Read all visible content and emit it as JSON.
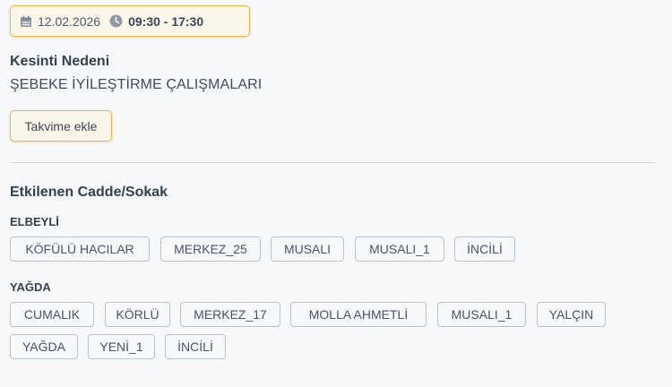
{
  "schedule": {
    "date": "12.02.2026",
    "time": "09:30 - 17:30",
    "icons": [
      "calendar-icon",
      "clock-icon"
    ]
  },
  "reason": {
    "label": "Kesinti Nedeni",
    "value": "ŞEBEKE İYİLEŞTİRME ÇALIŞMALARI"
  },
  "actions": {
    "add_to_calendar": "Takvime ekle"
  },
  "affected": {
    "title": "Etkilenen Cadde/Sokak",
    "groups": [
      {
        "name": "ELBEYLİ",
        "streets": [
          "KÖFÜLÜ HACILAR",
          "MERKEZ_25",
          "MUSALI",
          "MUSALI_1",
          "İNCİLİ"
        ]
      },
      {
        "name": "YAĞDA",
        "streets": [
          "CUMALIK",
          "KÖRLÜ",
          "MERKEZ_17",
          "MOLLA AHMETLİ",
          "MUSALI_1",
          "YALÇIN",
          "YAĞDA",
          "YENİ_1",
          "İNCİLİ"
        ]
      }
    ]
  },
  "colors": {
    "accent_border": "#e8b455",
    "accent_bg": "#fbf6ea",
    "chip_border": "#b9c2cc",
    "text": "#33414f"
  }
}
